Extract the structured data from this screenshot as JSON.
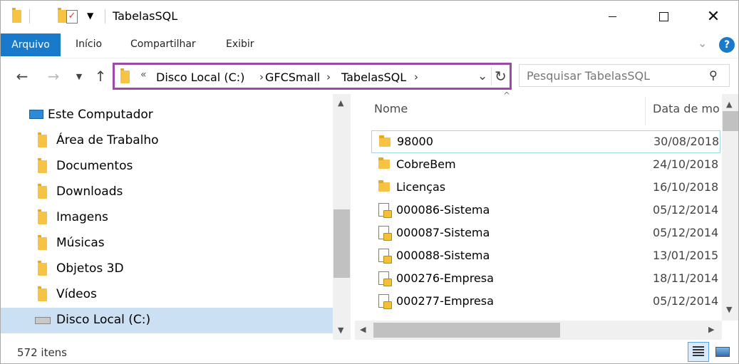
{
  "window": {
    "title": "TabelasSQL"
  },
  "ribbon": {
    "tabs": [
      "Arquivo",
      "Início",
      "Compartilhar",
      "Exibir"
    ],
    "help": "?"
  },
  "address": {
    "overflow": "«",
    "crumbs": [
      "Disco Local (C:)",
      "GFCSmall",
      "TabelasSQL"
    ]
  },
  "search": {
    "placeholder": "Pesquisar TabelasSQL"
  },
  "sidebar": {
    "items": [
      {
        "label": "Este Computador",
        "icon": "computer-icon"
      },
      {
        "label": "Área de Trabalho",
        "icon": "desktop-icon"
      },
      {
        "label": "Documentos",
        "icon": "documents-icon"
      },
      {
        "label": "Downloads",
        "icon": "downloads-icon"
      },
      {
        "label": "Imagens",
        "icon": "pictures-icon"
      },
      {
        "label": "Músicas",
        "icon": "music-icon"
      },
      {
        "label": "Objetos 3D",
        "icon": "3d-objects-icon"
      },
      {
        "label": "Vídeos",
        "icon": "videos-icon"
      },
      {
        "label": "Disco Local (C:)",
        "icon": "drive-icon"
      }
    ],
    "selected": "Disco Local (C:)"
  },
  "list": {
    "columns": [
      "Nome",
      "Data de mo"
    ],
    "rows": [
      {
        "name": "98000",
        "date": "30/08/2018",
        "type": "folder"
      },
      {
        "name": "CobreBem",
        "date": "24/10/2018",
        "type": "folder"
      },
      {
        "name": "Licenças",
        "date": "16/10/2018",
        "type": "folder"
      },
      {
        "name": "000086-Sistema",
        "date": "05/12/2014",
        "type": "file"
      },
      {
        "name": "000087-Sistema",
        "date": "05/12/2014",
        "type": "file"
      },
      {
        "name": "000088-Sistema",
        "date": "13/01/2015",
        "type": "file"
      },
      {
        "name": "000276-Empresa",
        "date": "18/11/2014",
        "type": "file"
      },
      {
        "name": "000277-Empresa",
        "date": "05/12/2014",
        "type": "file"
      }
    ]
  },
  "status": {
    "count": "572 itens"
  },
  "colors": {
    "accent": "#1979ca",
    "highlight_border": "#9b4aa5",
    "selection": "#cce0f3"
  }
}
